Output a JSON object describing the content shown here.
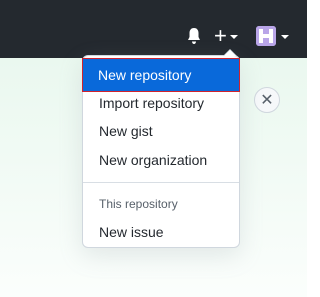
{
  "header": {
    "bell_icon": "bell-icon",
    "plus_icon": "plus-icon",
    "plus_glyph": "+",
    "avatar_icon": "avatar-identicon"
  },
  "banner": {
    "close_icon": "close-icon",
    "close_glyph": "✕"
  },
  "dropdown": {
    "items": [
      {
        "label": "New repository",
        "active": true
      },
      {
        "label": "Import repository"
      },
      {
        "label": "New gist"
      },
      {
        "label": "New organization"
      }
    ],
    "section_label": "This repository",
    "section_items": [
      {
        "label": "New issue"
      }
    ]
  },
  "colors": {
    "header_bg": "#24292f",
    "active_bg": "#0969da",
    "active_border": "#cf222e"
  }
}
